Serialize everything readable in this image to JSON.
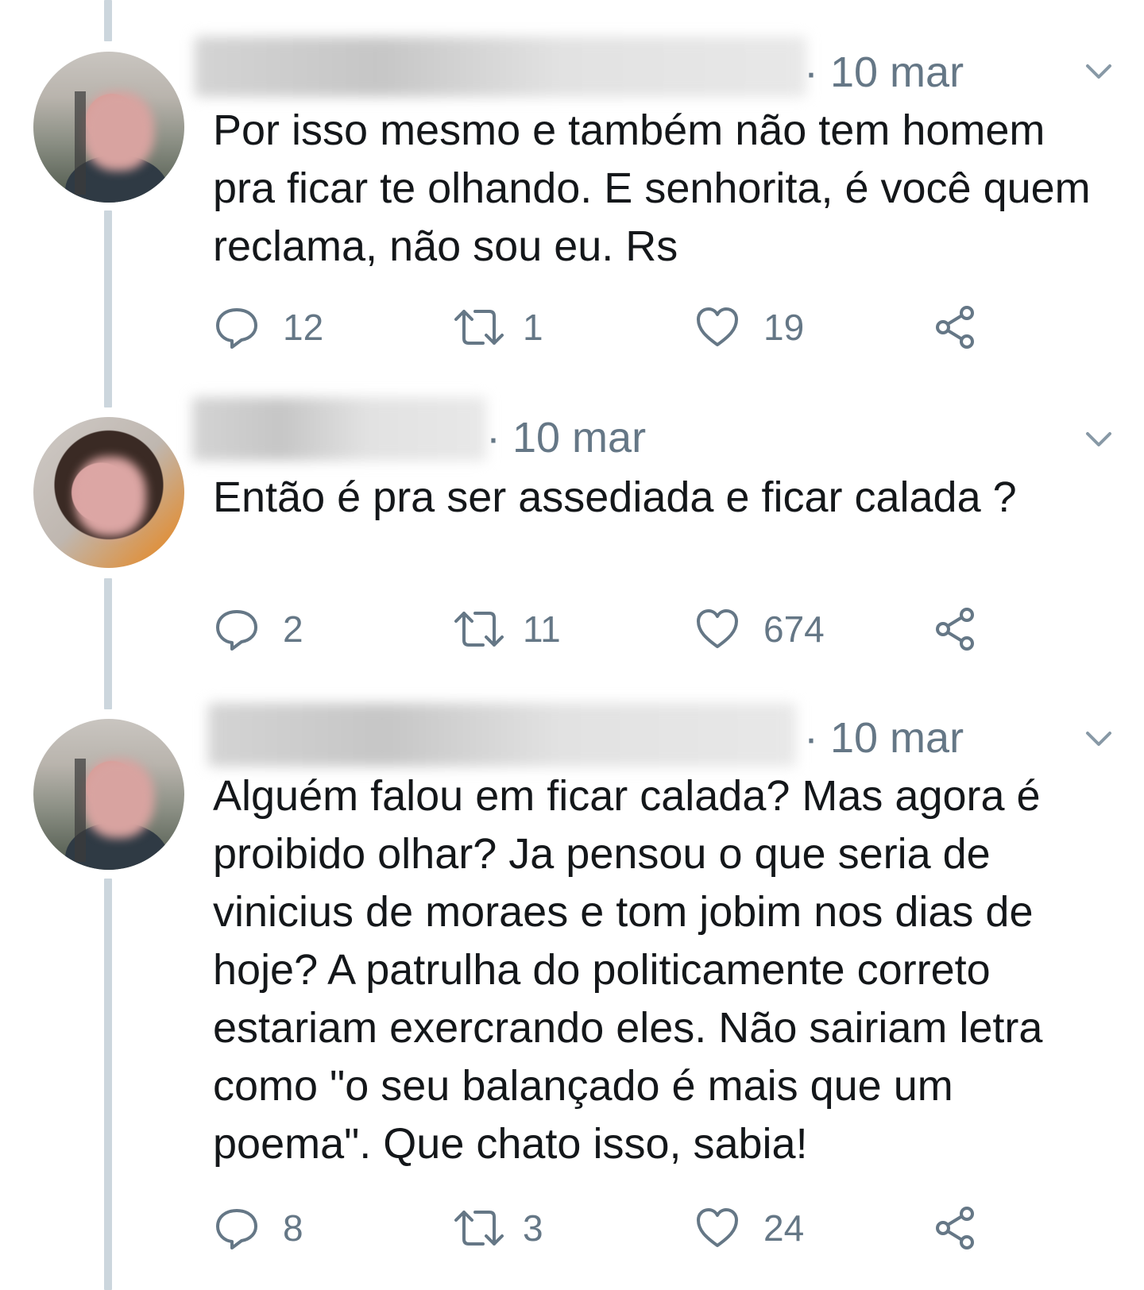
{
  "tweets": [
    {
      "date": "· 10 mar",
      "text": "Por isso mesmo e também não tem homem pra ficar te olhando. E senhorita, é você quem reclama, não sou eu. Rs",
      "replies": "12",
      "retweets": "1",
      "likes": "19"
    },
    {
      "date": "· 10 mar",
      "text": "Então é pra ser assediada e ficar calada ?",
      "replies": "2",
      "retweets": "11",
      "likes": "674"
    },
    {
      "date": "· 10 mar",
      "text": "Alguém falou em ficar calada? Mas agora é proibido olhar? Ja pensou o que seria de vinicius de moraes e tom jobim nos dias de hoje? A patrulha do politicamente correto estariam exercrando eles. Não sairiam letra como \"o seu balançado é mais que um poema\". Que chato isso, sabia!",
      "replies": "8",
      "retweets": "3",
      "likes": "24"
    }
  ],
  "icons": {
    "reply": "reply-icon",
    "retweet": "retweet-icon",
    "like": "heart-icon",
    "share": "share-icon",
    "menu": "chevron-down-icon"
  },
  "colors": {
    "text": "#14171a",
    "secondary": "#657786",
    "thread_line": "#ccd6dd"
  }
}
